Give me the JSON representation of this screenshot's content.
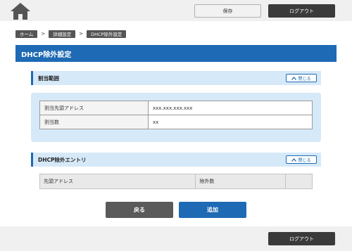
{
  "header": {
    "home_icon": "home-icon",
    "save_label": "保存",
    "logout_label": "ログアウト"
  },
  "breadcrumb": [
    "ホーム",
    "詳細設定",
    "DHCP除外設定"
  ],
  "page_title": "DHCP除外設定",
  "range_section": {
    "title": "割当範囲",
    "close_label": "閉じる",
    "rows": [
      {
        "label": "割当先頭アドレス",
        "value": "xxx.xxx.xxx.xxx"
      },
      {
        "label": "割当数",
        "value": "xx"
      }
    ]
  },
  "entry_section": {
    "title": "DHCP除外エントリ",
    "close_label": "閉じる",
    "columns": [
      "先頭アドレス",
      "除外数",
      ""
    ]
  },
  "actions": {
    "back_label": "戻る",
    "add_label": "追加"
  },
  "footer": {
    "logout_label": "ログアウト"
  },
  "colors": {
    "primary": "#1e6ab4",
    "dark": "#3a3a3a",
    "section_bg": "#d6e9f8"
  }
}
